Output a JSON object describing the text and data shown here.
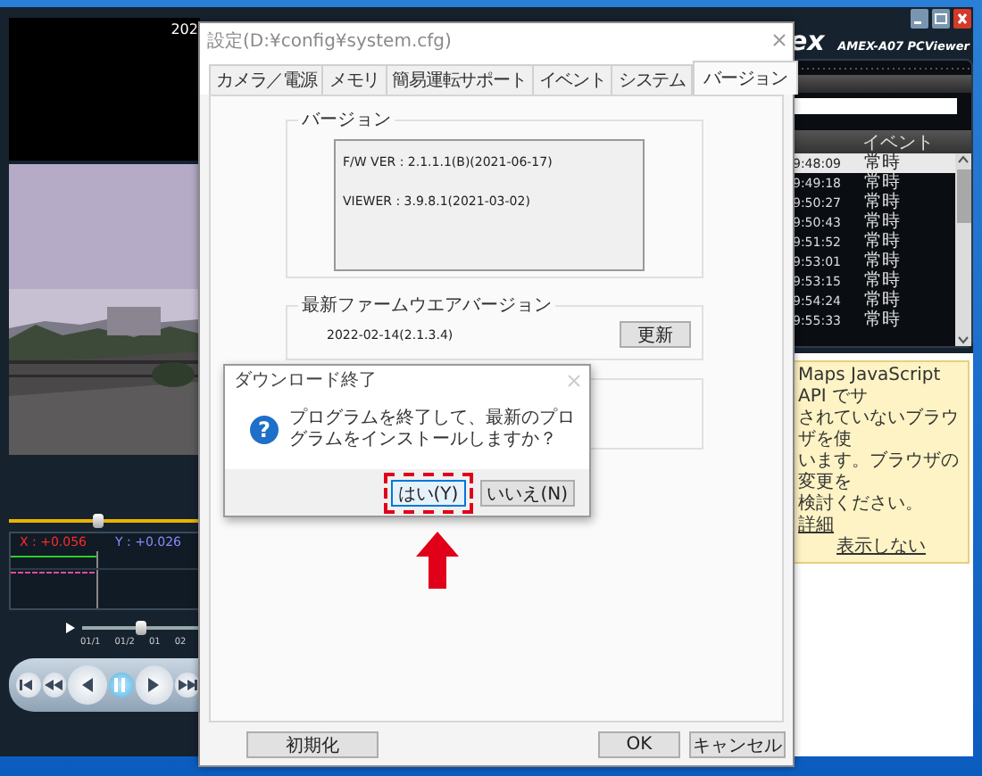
{
  "viewer": {
    "logo": "ex",
    "title": "AMEX-A07 PCViewer",
    "video": {
      "timestamp": "202"
    },
    "zoom_slider": {
      "level": 0.47
    },
    "sensor": {
      "x": "X : +0.056",
      "y": "Y : +0.026"
    },
    "playback": {
      "level": 0.5,
      "ticks": [
        "01/1",
        "01/2",
        "01",
        "02"
      ]
    },
    "media_buttons": [
      {
        "kind": "first",
        "active": false
      },
      {
        "kind": "prev",
        "active": false
      },
      {
        "kind": "reverse",
        "active": false
      },
      {
        "kind": "pause",
        "active": true
      },
      {
        "kind": "play",
        "active": false
      },
      {
        "kind": "next",
        "active": false
      }
    ],
    "events": {
      "column": "イベント",
      "rows": [
        {
          "time": "9:48:09",
          "event": "常時",
          "selected": true
        },
        {
          "time": "9:49:18",
          "event": "常時",
          "selected": false
        },
        {
          "time": "9:50:27",
          "event": "常時",
          "selected": false
        },
        {
          "time": "9:50:43",
          "event": "常時",
          "selected": false
        },
        {
          "time": "9:51:52",
          "event": "常時",
          "selected": false
        },
        {
          "time": "9:53:01",
          "event": "常時",
          "selected": false
        },
        {
          "time": "9:53:15",
          "event": "常時",
          "selected": false
        },
        {
          "time": "9:54:24",
          "event": "常時",
          "selected": false
        },
        {
          "time": "9:55:33",
          "event": "常時",
          "selected": false
        }
      ]
    },
    "notice": {
      "lines": [
        "Maps JavaScript API でサ",
        "されていないブラウザを使",
        "います。ブラウザの変更を",
        "検討ください。"
      ],
      "link": "詳細",
      "dismiss": "表示しない"
    }
  },
  "settings": {
    "title": "設定(D:¥config¥system.cfg)",
    "tabs": [
      {
        "label": "カメラ／電源",
        "selected": false
      },
      {
        "label": "メモリ",
        "selected": false
      },
      {
        "label": "簡易運転サポート",
        "selected": false
      },
      {
        "label": "イベント",
        "selected": false
      },
      {
        "label": "システム",
        "selected": false
      },
      {
        "label": "バージョン",
        "selected": true
      }
    ],
    "version_group": {
      "title": "バージョン",
      "lines": [
        "F/W VER : 2.1.1.1(B)(2021-06-17)",
        "VIEWER : 3.9.8.1(2021-03-02)"
      ]
    },
    "latest_group": {
      "title": "最新ファームウエアバージョン",
      "value": "2022-02-14(2.1.3.4)",
      "button": "更新"
    },
    "buttons": {
      "reset": "初期化",
      "ok": "OK",
      "cancel": "キャンセル"
    }
  },
  "message": {
    "title": "ダウンロード終了",
    "icon": "?",
    "text": "プログラムを終了して、最新のプログラムをインストールしますか？",
    "buttons": [
      {
        "label": "はい(Y)",
        "focused": true,
        "highlighted": true
      },
      {
        "label": "いいえ(N)",
        "focused": false,
        "highlighted": false
      }
    ]
  }
}
